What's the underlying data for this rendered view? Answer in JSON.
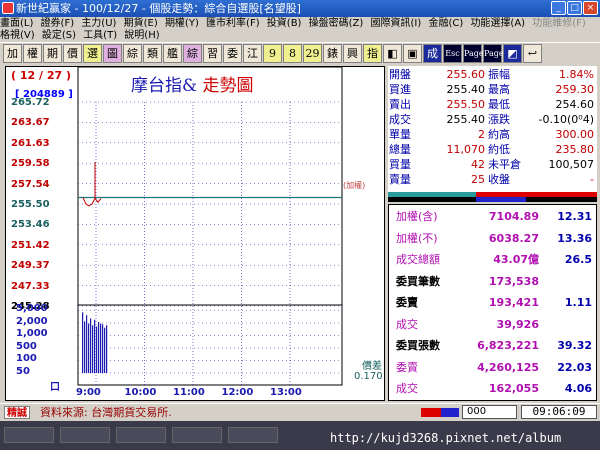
{
  "window": {
    "title": "新世紀贏家 - 100/12/27 - 個股走勢：綜合自選股[名望股]",
    "controls": [
      "_",
      "□",
      "×"
    ]
  },
  "menu_row1": [
    "畫面(L)",
    "證券(F)",
    "主力(U)",
    "期貨(E)",
    "期權(Y)",
    "匯市利率(F)",
    "投資(B)",
    "操盤密碼(Z)",
    "國際資訊(I)",
    "金融(C)",
    "功能選擇(A)",
    "功能維修(F)"
  ],
  "menu_row2": [
    "格視(V)",
    "設定(S)",
    "工具(T)",
    "說明(H)"
  ],
  "toolbar": [
    "加",
    "權",
    "期",
    "價",
    "選",
    "圖",
    "綜",
    "類",
    "艦",
    "綜",
    "習",
    "委",
    "江",
    "9",
    "8",
    "29",
    "錶",
    "興",
    "指",
    "◧",
    "▣",
    "成",
    "Esc",
    "Page Up",
    "Page Down",
    "◩",
    "↩"
  ],
  "chart": {
    "date_label": "( 12 / 27 )",
    "title_part1": "摩台指&",
    "title_part2": "走勢圖",
    "volume_label": "[ 204889 ]",
    "diff_label": "價差",
    "diff_value": "0.170",
    "jiaquan_label": "(加權)",
    "price_ticks": [
      "265.72",
      "263.67",
      "261.63",
      "259.58",
      "257.54",
      "255.50",
      "253.46",
      "251.42",
      "249.37",
      "247.33",
      "245.28"
    ],
    "price_tick_colors": [
      "#1a6060",
      "#c00000",
      "#c00000",
      "#c00000",
      "#c00000",
      "#1a6060",
      "#1a6060",
      "#c00000",
      "#c00000",
      "#c00000",
      "#000000"
    ],
    "volume_ticks": [
      "5,000",
      "2,000",
      "1,000",
      "500",
      "100",
      "50",
      "口"
    ],
    "time_ticks": [
      "9:00",
      "10:00",
      "11:00",
      "12:00",
      "13:00"
    ]
  },
  "chart_data": {
    "type": "line",
    "title": "摩台指& 走勢圖",
    "xlabel": "",
    "ylabel": "",
    "ylim": [
      245.28,
      265.72
    ],
    "reference_price": 255.5,
    "x": [
      "9:00",
      "9:01",
      "9:02",
      "9:03",
      "9:04",
      "9:05",
      "9:06"
    ],
    "series": [
      {
        "values": [
          255.5,
          254.8,
          254.6,
          254.8,
          255.4,
          255.0,
          255.4
        ]
      }
    ],
    "volume": [
      4200,
      1200,
      2800,
      900,
      1800,
      700,
      1500,
      600,
      1100,
      900,
      800,
      500,
      700
    ]
  },
  "quote": {
    "rows": [
      {
        "l1": "開盤",
        "v1": "255.60",
        "l2": "振幅",
        "v2": "1.84%",
        "c1": "#c00000",
        "c2": "#c00000"
      },
      {
        "l1": "買進",
        "v1": "255.40",
        "l2": "最高",
        "v2": "259.30",
        "c1": "#000000",
        "c2": "#c00000"
      },
      {
        "l1": "賣出",
        "v1": "255.50",
        "l2": "最低",
        "v2": "254.60",
        "c1": "#c00000",
        "c2": "#000000"
      },
      {
        "l1": "成交",
        "v1": "255.40",
        "l2": "漲跌",
        "v2": "-0.10(0⁰4)",
        "c1": "#000000",
        "c2": "#000000"
      },
      {
        "l1": "單量",
        "v1": "2",
        "l2": "約高",
        "v2": "300.00",
        "c1": "#c00000",
        "c2": "#c00000"
      },
      {
        "l1": "總量",
        "v1": "11,070",
        "l2": "約低",
        "v2": "235.80",
        "c1": "#c00000",
        "c2": "#c00000"
      },
      {
        "l1": "買量",
        "v1": "42",
        "l2": "未平倉",
        "v2": "100,507",
        "c1": "#c00000",
        "c2": "#000000"
      },
      {
        "l1": "賣量",
        "v1": "25",
        "l2": "收盤",
        "v2": "-",
        "c1": "#c00000",
        "c2": "#c00000"
      }
    ]
  },
  "index_panel": [
    {
      "label": "加權(含)",
      "value": "7104.89",
      "right": "12.31",
      "bold_label": false
    },
    {
      "label": "加權(不)",
      "value": "6038.27",
      "right": "13.36",
      "bold_label": false
    },
    {
      "label": "成交總額",
      "value": "43.07億",
      "right": "26.5",
      "bold_label": false
    },
    {
      "label": "委買筆數",
      "value": "173,538",
      "right": "",
      "bold_label": true
    },
    {
      "label": "委賣",
      "value": "193,421",
      "right": "1.11",
      "bold_label": true
    },
    {
      "label": "成交",
      "value": "39,926",
      "right": "",
      "bold_label": false
    },
    {
      "label": "委買張數",
      "value": "6,823,221",
      "right": "39.32",
      "bold_label": true
    },
    {
      "label": "委賣",
      "value": "4,260,125",
      "right": "22.03",
      "bold_label": false
    },
    {
      "label": "成交",
      "value": "162,055",
      "right": "4.06",
      "bold_label": false
    }
  ],
  "status": {
    "badge": "精誠",
    "source": "資料來源: 台灣期貨交易所.",
    "input_value": "000",
    "clock": "09:06:09"
  },
  "taskbar": {
    "url": "http://kujd3268.pixnet.net/album"
  }
}
